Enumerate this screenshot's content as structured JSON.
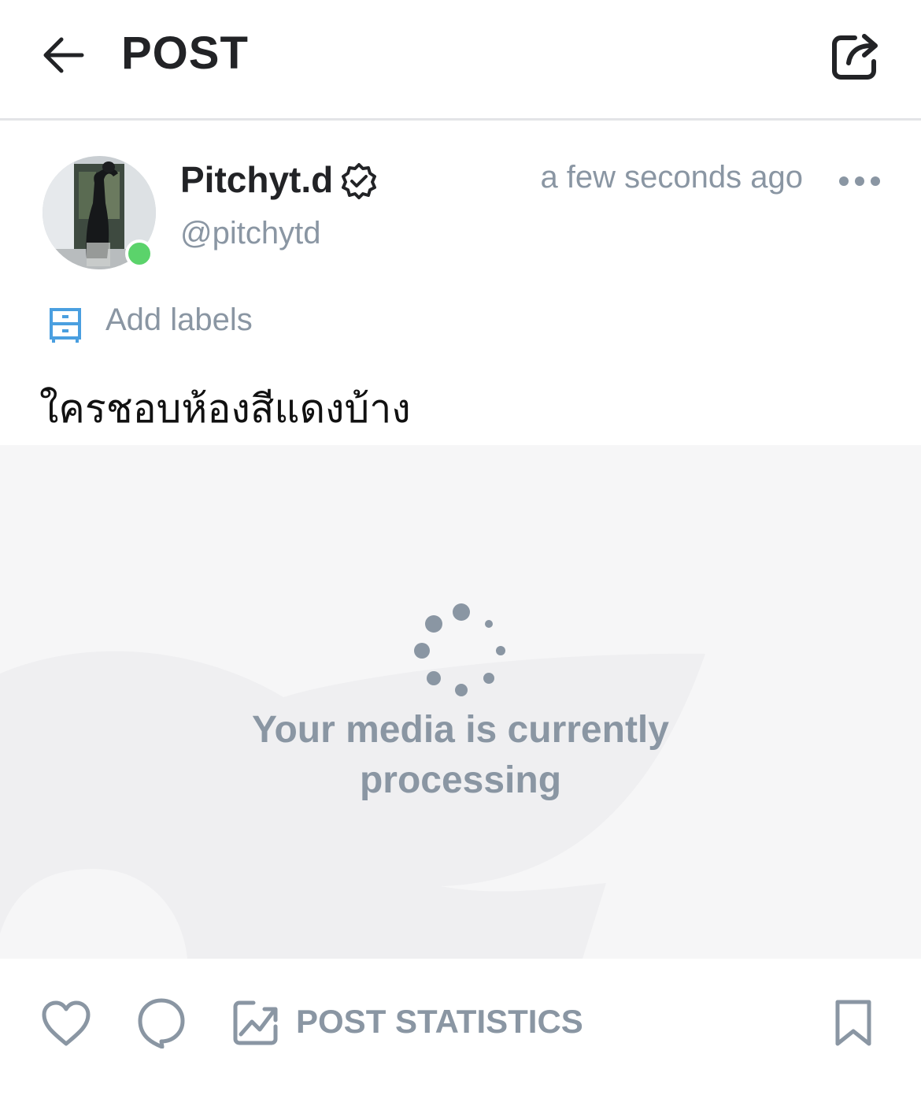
{
  "header": {
    "title": "POST",
    "back_icon": "arrow-left-icon",
    "share_icon": "share-icon"
  },
  "post": {
    "author": {
      "name": "Pitchyt.d",
      "handle": "@pitchytd",
      "verified": true,
      "online": true
    },
    "timestamp": "a few seconds ago",
    "more_icon": "more-horizontal-icon",
    "labels_text": "Add labels",
    "text": "ใครชอบห้องสีแดงบ้าง",
    "media": {
      "status_text_line1": "Your media is currently",
      "status_text_line2": "processing"
    }
  },
  "actions": {
    "like_icon": "heart-icon",
    "comment_icon": "comment-icon",
    "stats_label": "POST STATISTICS",
    "bookmark_icon": "bookmark-icon"
  },
  "colors": {
    "text_primary": "#222326",
    "text_secondary": "#8a96a3",
    "accent": "#00aff0",
    "online": "#5bd36b",
    "media_bg": "#f6f6f7"
  }
}
